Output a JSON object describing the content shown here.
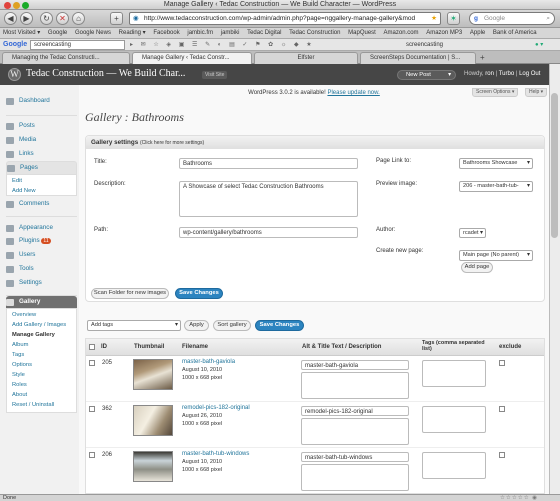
{
  "browser": {
    "window_title": "Manage Gallery ‹ Tedac Construction — We Build Character — WordPress",
    "url": "http://www.tedacconstruction.com/wp-admin/admin.php?page=nggallery-manage-gallery&mod",
    "search_placeholder": "Google",
    "bookmarks": [
      "Most Visited ▾",
      "Google",
      "Google News",
      "Reading ▾",
      "Facebook",
      "jambic.fm",
      "jambiki",
      "Tedac Digital",
      "Tedac Construction",
      "MapQuest",
      "Amazon.com",
      "Amazon MP3",
      "Apple",
      "Bank of America"
    ],
    "google_toolbar": {
      "logo": "Google",
      "query": "screencasting",
      "query2": "screencasting"
    },
    "tabs": [
      "Managing the Tedac Constructi...",
      "Manage Gallery ‹ Tedac Constr...",
      "Elfster",
      "ScreenSteps Documentation | S..."
    ],
    "status": "Done"
  },
  "wp": {
    "site_title": "Tedac Construction — We Build Char...",
    "visit_site": "Visit Site",
    "new_post": "New Post",
    "greeting": "Howdy,",
    "user": "ron",
    "turbo": "Turbo",
    "logout": "Log Out",
    "screen_options": "Screen Options ▾",
    "help": "Help ▾",
    "update_notice": "WordPress 3.0.2 is available!",
    "update_link": "Please update now."
  },
  "sidebar": {
    "dashboard": "Dashboard",
    "posts": "Posts",
    "media": "Media",
    "links": "Links",
    "pages": "Pages",
    "pages_sub": [
      "Edit",
      "Add New"
    ],
    "comments": "Comments",
    "appearance": "Appearance",
    "plugins": "Plugins",
    "plugins_badge": "11",
    "users": "Users",
    "tools": "Tools",
    "settings": "Settings",
    "gallery": "Gallery",
    "gallery_sub": [
      "Overview",
      "Add Gallery / Images",
      "Manage Gallery",
      "Album",
      "Tags",
      "Options",
      "Style",
      "Roles",
      "About",
      "Reset / Uninstall"
    ]
  },
  "page": {
    "heading": "Gallery : Bathrooms",
    "settings_title": "Gallery settings",
    "settings_hint": "(Click here for more settings)",
    "title_label": "Title:",
    "title_value": "Bathrooms",
    "description_label": "Description:",
    "description_value": "A Showcase of select Tedac Construction Bathrooms",
    "path_label": "Path:",
    "path_value": "wp-content/gallery/bathrooms",
    "page_link_label": "Page Link to:",
    "page_link_value": "Bathrooms Showcase",
    "preview_label": "Preview image:",
    "preview_value": "206 - master-bath-tub-",
    "author_label": "Author:",
    "author_value": "rcadet",
    "create_page_label": "Create new page:",
    "create_page_value": "Main page (No parent)",
    "add_page": "Add page",
    "scan_folder": "Scan Folder for new images",
    "save_changes": "Save Changes",
    "bulk_action": "Add tags",
    "apply": "Apply",
    "sort_gallery": "Sort gallery",
    "save_changes2": "Save Changes"
  },
  "table": {
    "headers": {
      "id": "ID",
      "thumbnail": "Thumbnail",
      "filename": "Filename",
      "alt": "Alt & Title Text / Description",
      "tags": "Tags (comma separated list)",
      "exclude": "exclude"
    },
    "rows": [
      {
        "id": "205",
        "filename": "master-bath-gaviola",
        "date": "August 10, 2010",
        "size": "1000 x 668 pixel",
        "alt": "master-bath-gaviola"
      },
      {
        "id": "362",
        "filename": "remodel-pics-182-original",
        "date": "August 26, 2010",
        "size": "1000 x 668 pixel",
        "alt": "remodel-pics-182-original"
      },
      {
        "id": "206",
        "filename": "master-bath-tub-windows",
        "date": "August 10, 2010",
        "size": "1000 x 668 pixel",
        "alt": "master-bath-tub-windows"
      }
    ]
  }
}
